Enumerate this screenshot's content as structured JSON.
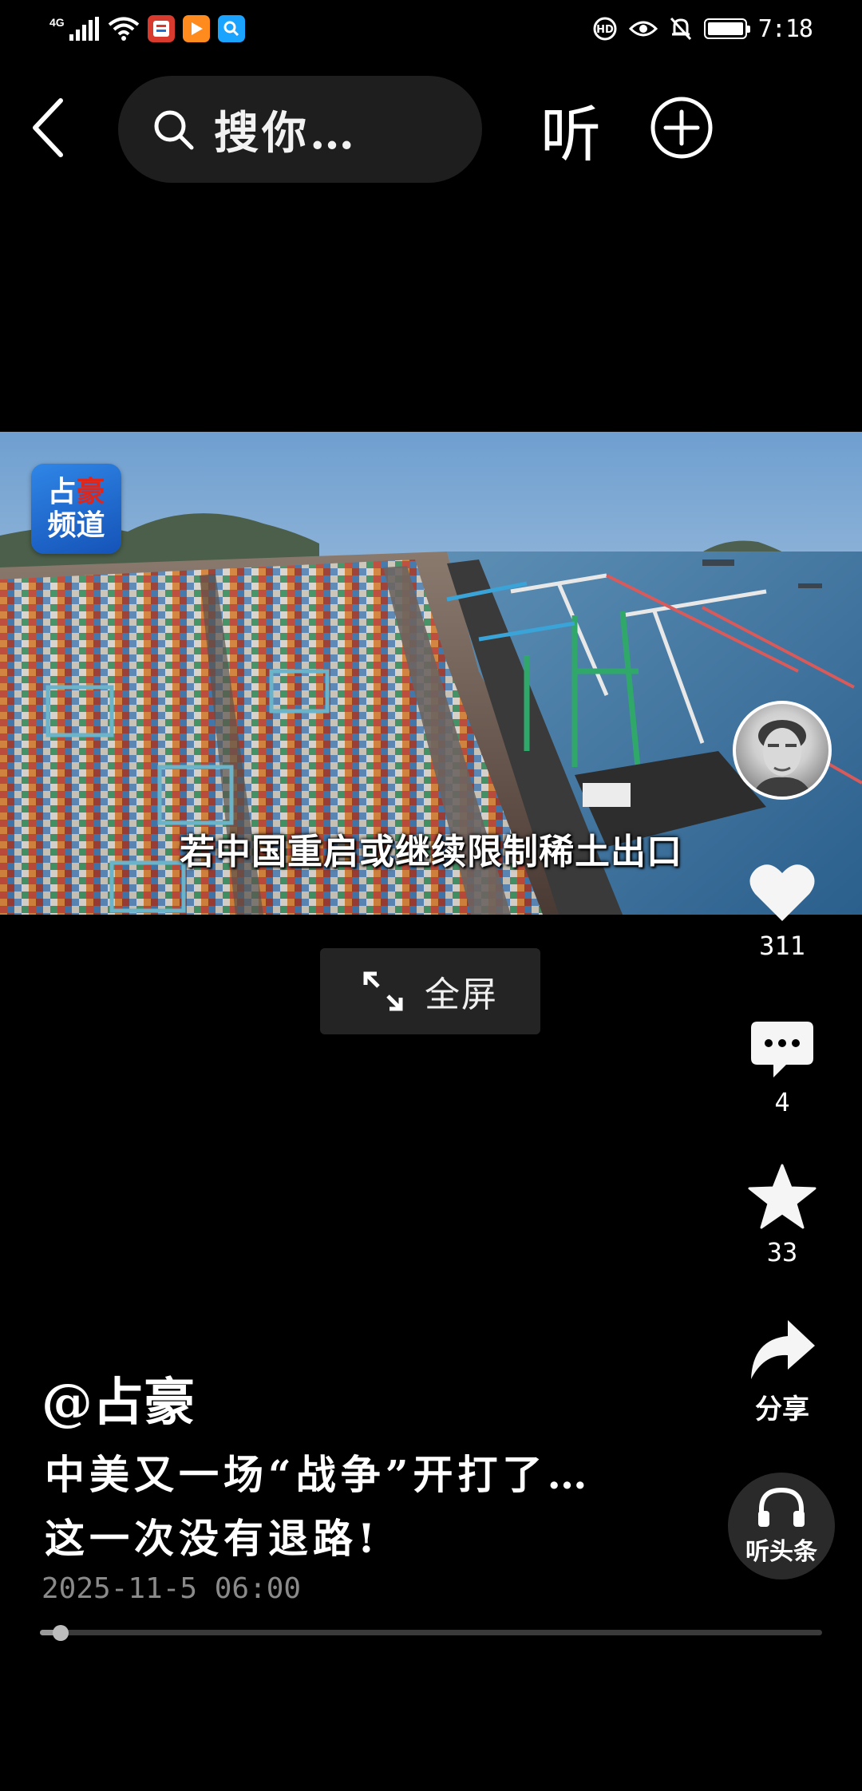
{
  "status_bar": {
    "network": "4G",
    "time": "7:18",
    "battery_level": 1.0,
    "icons": [
      "signal-icon",
      "wifi-icon",
      "app-notification-icon",
      "video-app-icon",
      "search-app-icon",
      "hd-call-icon",
      "eye-comfort-icon",
      "mute-bell-icon",
      "battery-icon"
    ]
  },
  "top_bar": {
    "search_text": "搜你…",
    "listen_label": "听"
  },
  "video": {
    "channel_logo_line1_a": "占",
    "channel_logo_line1_b": "豪",
    "channel_logo_line2": "频道",
    "subtitle": "若中国重启或继续限制稀土出口",
    "fullscreen_label": "全屏"
  },
  "actions": {
    "likes": "311",
    "comments": "4",
    "favorites": "33",
    "share_label": "分享",
    "listen_headlines_label": "听头条"
  },
  "post": {
    "author": "@占豪",
    "caption_line1": "中美又一场“战争”开打了…",
    "caption_line2": "这一次没有退路!",
    "date": "2025-11-5 06:00",
    "progress": 0.027
  },
  "colors": {
    "background": "#000000",
    "search_bg": "#1e1e1e",
    "logo_blue": "#1f6fd6",
    "logo_red": "#e0251b"
  }
}
